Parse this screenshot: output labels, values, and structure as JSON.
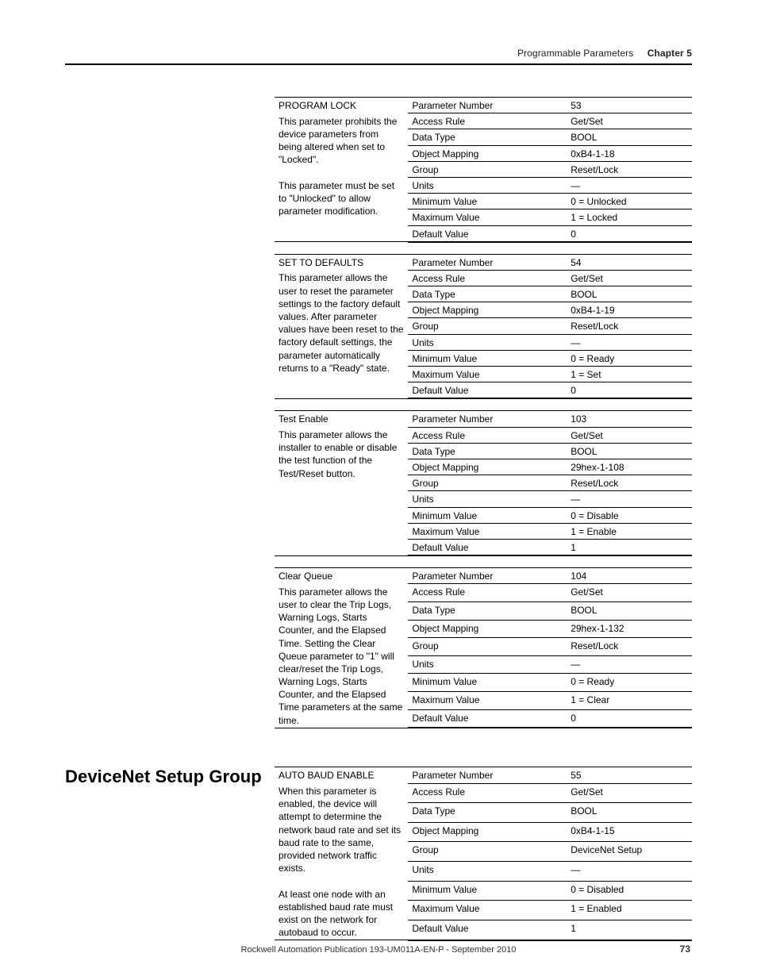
{
  "header": {
    "section_name": "Programmable Parameters",
    "chapter_label": "Chapter 5"
  },
  "row_labels": {
    "parameter_number": "Parameter Number",
    "access_rule": "Access Rule",
    "data_type": "Data Type",
    "object_mapping": "Object Mapping",
    "group": "Group",
    "units": "Units",
    "minimum_value": "Minimum Value",
    "maximum_value": "Maximum Value",
    "default_value": "Default Value"
  },
  "tables": [
    {
      "name": "PROGRAM LOCK",
      "description": "This parameter prohibits the device parameters from being altered when set to \"Locked\".\n\nThis parameter must be set to \"Unlocked\" to allow parameter modification.",
      "values": {
        "parameter_number": "53",
        "access_rule": "Get/Set",
        "data_type": "BOOL",
        "object_mapping": "0xB4-1-18",
        "group": "Reset/Lock",
        "units": "—",
        "minimum_value": "0 = Unlocked",
        "maximum_value": "1 = Locked",
        "default_value": "0"
      }
    },
    {
      "name": "SET TO DEFAULTS",
      "description": "This parameter allows the user to reset the parameter settings to the factory default values. After parameter values have been reset to the factory default settings, the parameter automatically returns to a \"Ready\" state.",
      "values": {
        "parameter_number": "54",
        "access_rule": "Get/Set",
        "data_type": "BOOL",
        "object_mapping": "0xB4-1-19",
        "group": "Reset/Lock",
        "units": "—",
        "minimum_value": "0 = Ready",
        "maximum_value": "1 = Set",
        "default_value": "0"
      }
    },
    {
      "name": "Test Enable",
      "description": "This parameter allows the installer to enable or disable the test function of the Test/Reset button.",
      "values": {
        "parameter_number": "103",
        "access_rule": "Get/Set",
        "data_type": "BOOL",
        "object_mapping": "29hex-1-108",
        "group": "Reset/Lock",
        "units": "—",
        "minimum_value": "0 = Disable",
        "maximum_value": "1 = Enable",
        "default_value": "1"
      }
    },
    {
      "name": "Clear Queue",
      "description": "This parameter allows the user to clear the Trip Logs, Warning Logs, Starts Counter, and the Elapsed Time.  Setting the Clear Queue parameter to \"1\" will clear/reset the Trip Logs, Warning Logs, Starts Counter, and the Elapsed Time parameters at the same time.",
      "values": {
        "parameter_number": "104",
        "access_rule": "Get/Set",
        "data_type": "BOOL",
        "object_mapping": "29hex-1-132",
        "group": "Reset/Lock",
        "units": "—",
        "minimum_value": "0 = Ready",
        "maximum_value": "1 = Clear",
        "default_value": "0"
      }
    }
  ],
  "section2": {
    "title": "DeviceNet Setup Group",
    "tables": [
      {
        "name": "AUTO BAUD ENABLE",
        "description": "When this parameter is enabled, the device will attempt to determine the network baud rate and set its baud rate to the same, provided network traffic exists.\n\nAt least one node with an established baud rate must exist on the network for autobaud to occur.",
        "values": {
          "parameter_number": "55",
          "access_rule": "Get/Set",
          "data_type": "BOOL",
          "object_mapping": "0xB4-1-15",
          "group": "DeviceNet Setup",
          "units": "—",
          "minimum_value": "0 = Disabled",
          "maximum_value": "1 = Enabled",
          "default_value": "1"
        }
      }
    ]
  },
  "footer": {
    "publication": "Rockwell Automation Publication 193-UM011A-EN-P - September 2010",
    "page": "73"
  }
}
